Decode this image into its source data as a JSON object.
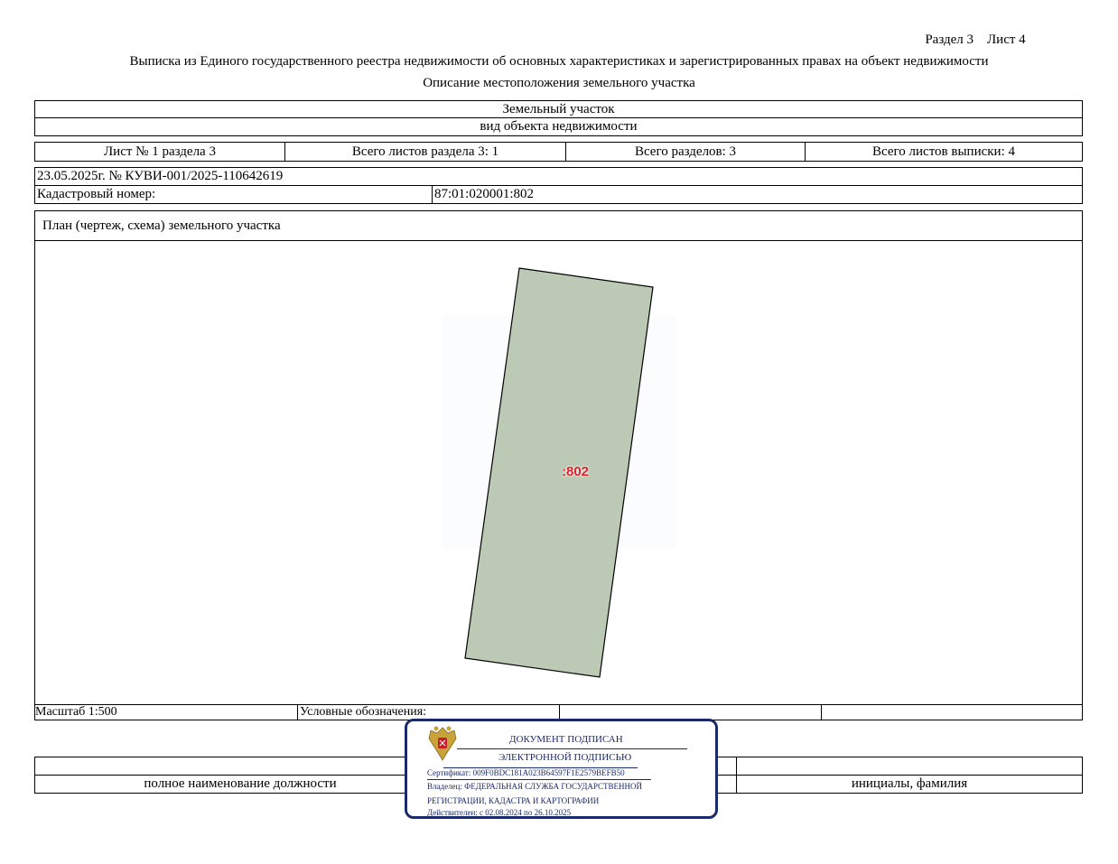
{
  "header": {
    "section_sheet": "Раздел 3    Лист 4",
    "title": "Выписка из Единого государственного реестра недвижимости об основных характеристиках и зарегистрированных правах на объект недвижимости",
    "subtitle": "Описание местоположения земельного участка"
  },
  "object": {
    "type": "Земельный участок",
    "type_caption": "вид объекта недвижимости"
  },
  "sheets": {
    "sheet_of_section": "Лист № 1 раздела 3",
    "total_section_sheets": "Всего листов раздела 3: 1",
    "total_sections": "Всего разделов: 3",
    "total_extract_sheets": "Всего листов выписки: 4"
  },
  "record": {
    "date_number": "23.05.2025г. № КУВИ-001/2025-110642619",
    "cadastral_label": "Кадастровый номер:",
    "cadastral_value": "87:01:020001:802"
  },
  "plan": {
    "heading": "План (чертеж, схема) земельного участка",
    "parcel_label": ":802",
    "parcel_fill": "#bccab5",
    "label_color": "#e0202a"
  },
  "legend_row": {
    "scale": "Масштаб 1:500",
    "legend": "Условные обозначения:"
  },
  "signature_row": {
    "position_caption": "полное наименование должности",
    "name_caption": "инициалы, фамилия"
  },
  "stamp": {
    "line1": "ДОКУМЕНТ ПОДПИСАН",
    "line2": "ЭЛЕКТРОННОЙ ПОДПИСЬЮ",
    "certificate": "Сертификат: 009F0BDC181A023B64597F1E2579BEFB50",
    "owner1": "Владелец: ФЕДЕРАЛЬНАЯ СЛУЖБА ГОСУДАРСТВЕННОЙ",
    "owner2": "РЕГИСТРАЦИИ, КАДАСТРА И КАРТОГРАФИИ",
    "valid": "Действителен: с 02.08.2024 по 26.10.2025",
    "color": "#1b2a6b",
    "emblem": "russian-coat-of-arms-icon"
  }
}
